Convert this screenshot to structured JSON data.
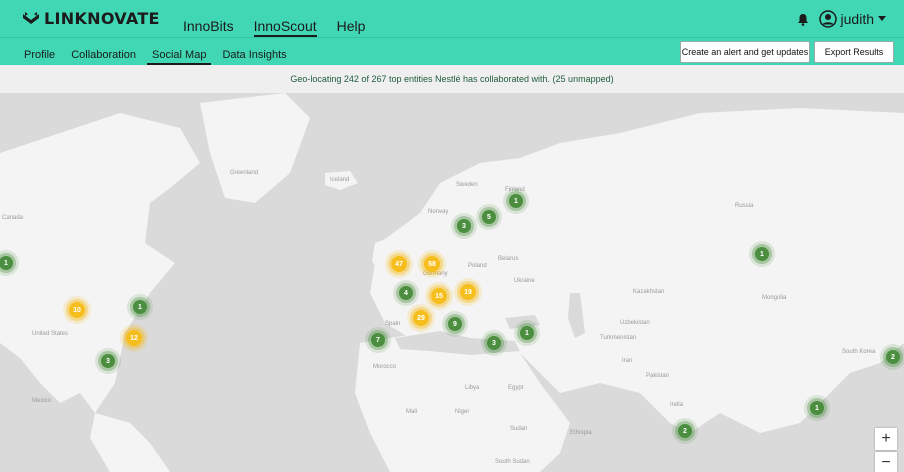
{
  "header": {
    "logo_text": "LINKNOVATE",
    "nav": [
      {
        "label": "InnoBits",
        "active": false
      },
      {
        "label": "InnoScout",
        "active": true
      },
      {
        "label": "Help",
        "active": false
      }
    ],
    "user_name": "judith",
    "icons": {
      "bell": "bell-icon",
      "user": "user-circle-icon",
      "caret": "caret-down-icon"
    }
  },
  "subnav": {
    "tabs": [
      {
        "label": "Profile"
      },
      {
        "label": "Collaboration"
      },
      {
        "label": "Social Map",
        "active": true
      },
      {
        "label": "Data Insights"
      }
    ],
    "alert_button": "Create an alert and get updates",
    "export_button": "Export Results"
  },
  "info_text": "Geo-locating 242 of 267 top entities Nestlé has collaborated with. (25 unmapped)",
  "map": {
    "labels": [
      "Greenland",
      "Iceland",
      "Canada",
      "Sweden",
      "Norway",
      "Finland",
      "Russia",
      "Poland",
      "Belarus",
      "Ukraine",
      "Germany",
      "Kazakhstan",
      "Mongolia",
      "Spain",
      "Uzbekistan",
      "Turkmenistan",
      "Iran",
      "Pakistan",
      "Morocco",
      "Libya",
      "Egypt",
      "Mali",
      "Niger",
      "Sudan",
      "Ethiopia",
      "India",
      "South Sudan",
      "United States",
      "Mexico",
      "South Korea"
    ],
    "clusters": [
      {
        "count": "1",
        "color": "green"
      },
      {
        "count": "10",
        "color": "yellow"
      },
      {
        "count": "1",
        "color": "green"
      },
      {
        "count": "12",
        "color": "yellow"
      },
      {
        "count": "3",
        "color": "green"
      },
      {
        "count": "47",
        "color": "yellow"
      },
      {
        "count": "58",
        "color": "yellow"
      },
      {
        "count": "4",
        "color": "green"
      },
      {
        "count": "15",
        "color": "yellow"
      },
      {
        "count": "19",
        "color": "yellow"
      },
      {
        "count": "29",
        "color": "yellow"
      },
      {
        "count": "9",
        "color": "green"
      },
      {
        "count": "7",
        "color": "green"
      },
      {
        "count": "3",
        "color": "green"
      },
      {
        "count": "1",
        "color": "green"
      },
      {
        "count": "3",
        "color": "green"
      },
      {
        "count": "5",
        "color": "green"
      },
      {
        "count": "1",
        "color": "green"
      },
      {
        "count": "1",
        "color": "green"
      },
      {
        "count": "2",
        "color": "green"
      },
      {
        "count": "1",
        "color": "green"
      },
      {
        "count": "2",
        "color": "green"
      }
    ],
    "zoom_in": "+",
    "zoom_out": "−"
  },
  "colors": {
    "brand": "#41d6b4",
    "cluster_green": "#4b8e3f",
    "cluster_yellow": "#f6be1d",
    "info_text": "#1e5c3c"
  }
}
